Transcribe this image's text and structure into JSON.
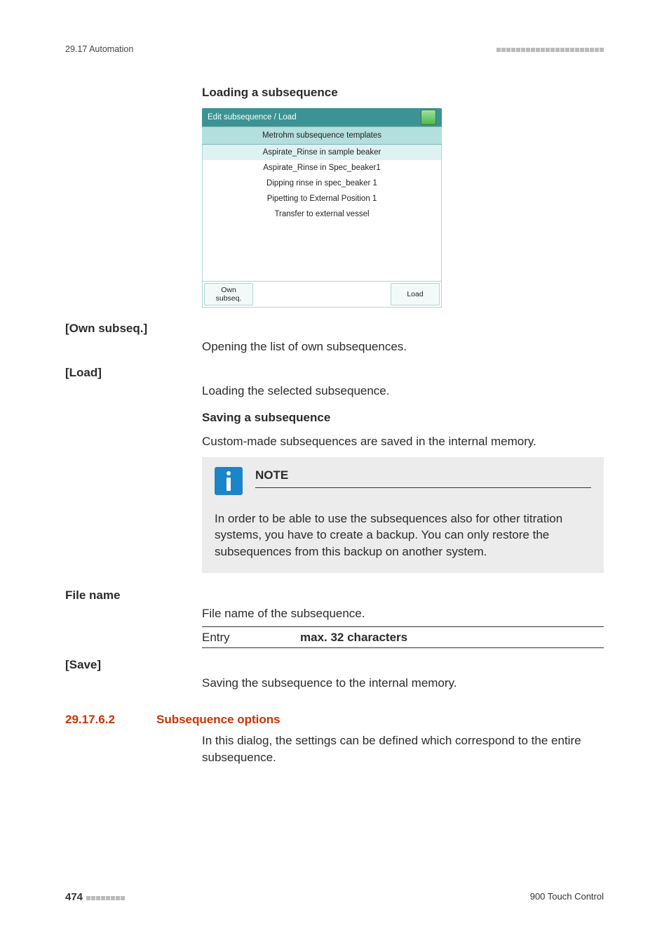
{
  "header": {
    "left": "29.17 Automation"
  },
  "h1": "Loading a subsequence",
  "screenshot": {
    "titlebar": "Edit subsequence / Load",
    "list_header": "Metrohm subsequence templates",
    "items": [
      "Aspirate_Rinse in sample beaker",
      "Aspirate_Rinse in Spec_beaker1",
      "Dipping rinse in spec_beaker 1",
      "Pipetting to External Position 1",
      "Transfer to external vessel"
    ],
    "btn_own_l1": "Own",
    "btn_own_l2": "subseq.",
    "btn_load": "Load"
  },
  "own_subseq": {
    "label": "[Own subseq.]",
    "text": "Opening the list of own subsequences."
  },
  "load": {
    "label": "[Load]",
    "text": "Loading the selected subsequence."
  },
  "h2": "Saving a subsequence",
  "h2_para": "Custom-made subsequences are saved in the internal memory.",
  "note": {
    "title": "NOTE",
    "body": "In order to be able to use the subsequences also for other titration systems, you have to create a backup. You can only restore the subsequences from this backup on another system."
  },
  "file_name": {
    "label": "File name",
    "text": "File name of the subsequence."
  },
  "entry": {
    "label": "Entry",
    "value": "max. 32 characters"
  },
  "save": {
    "label": "[Save]",
    "text": "Saving the subsequence to the internal memory."
  },
  "section": {
    "num": "29.17.6.2",
    "title": "Subsequence options",
    "para": "In this dialog, the settings can be defined which correspond to the entire subsequence."
  },
  "footer": {
    "page": "474",
    "product": "900 Touch Control"
  }
}
